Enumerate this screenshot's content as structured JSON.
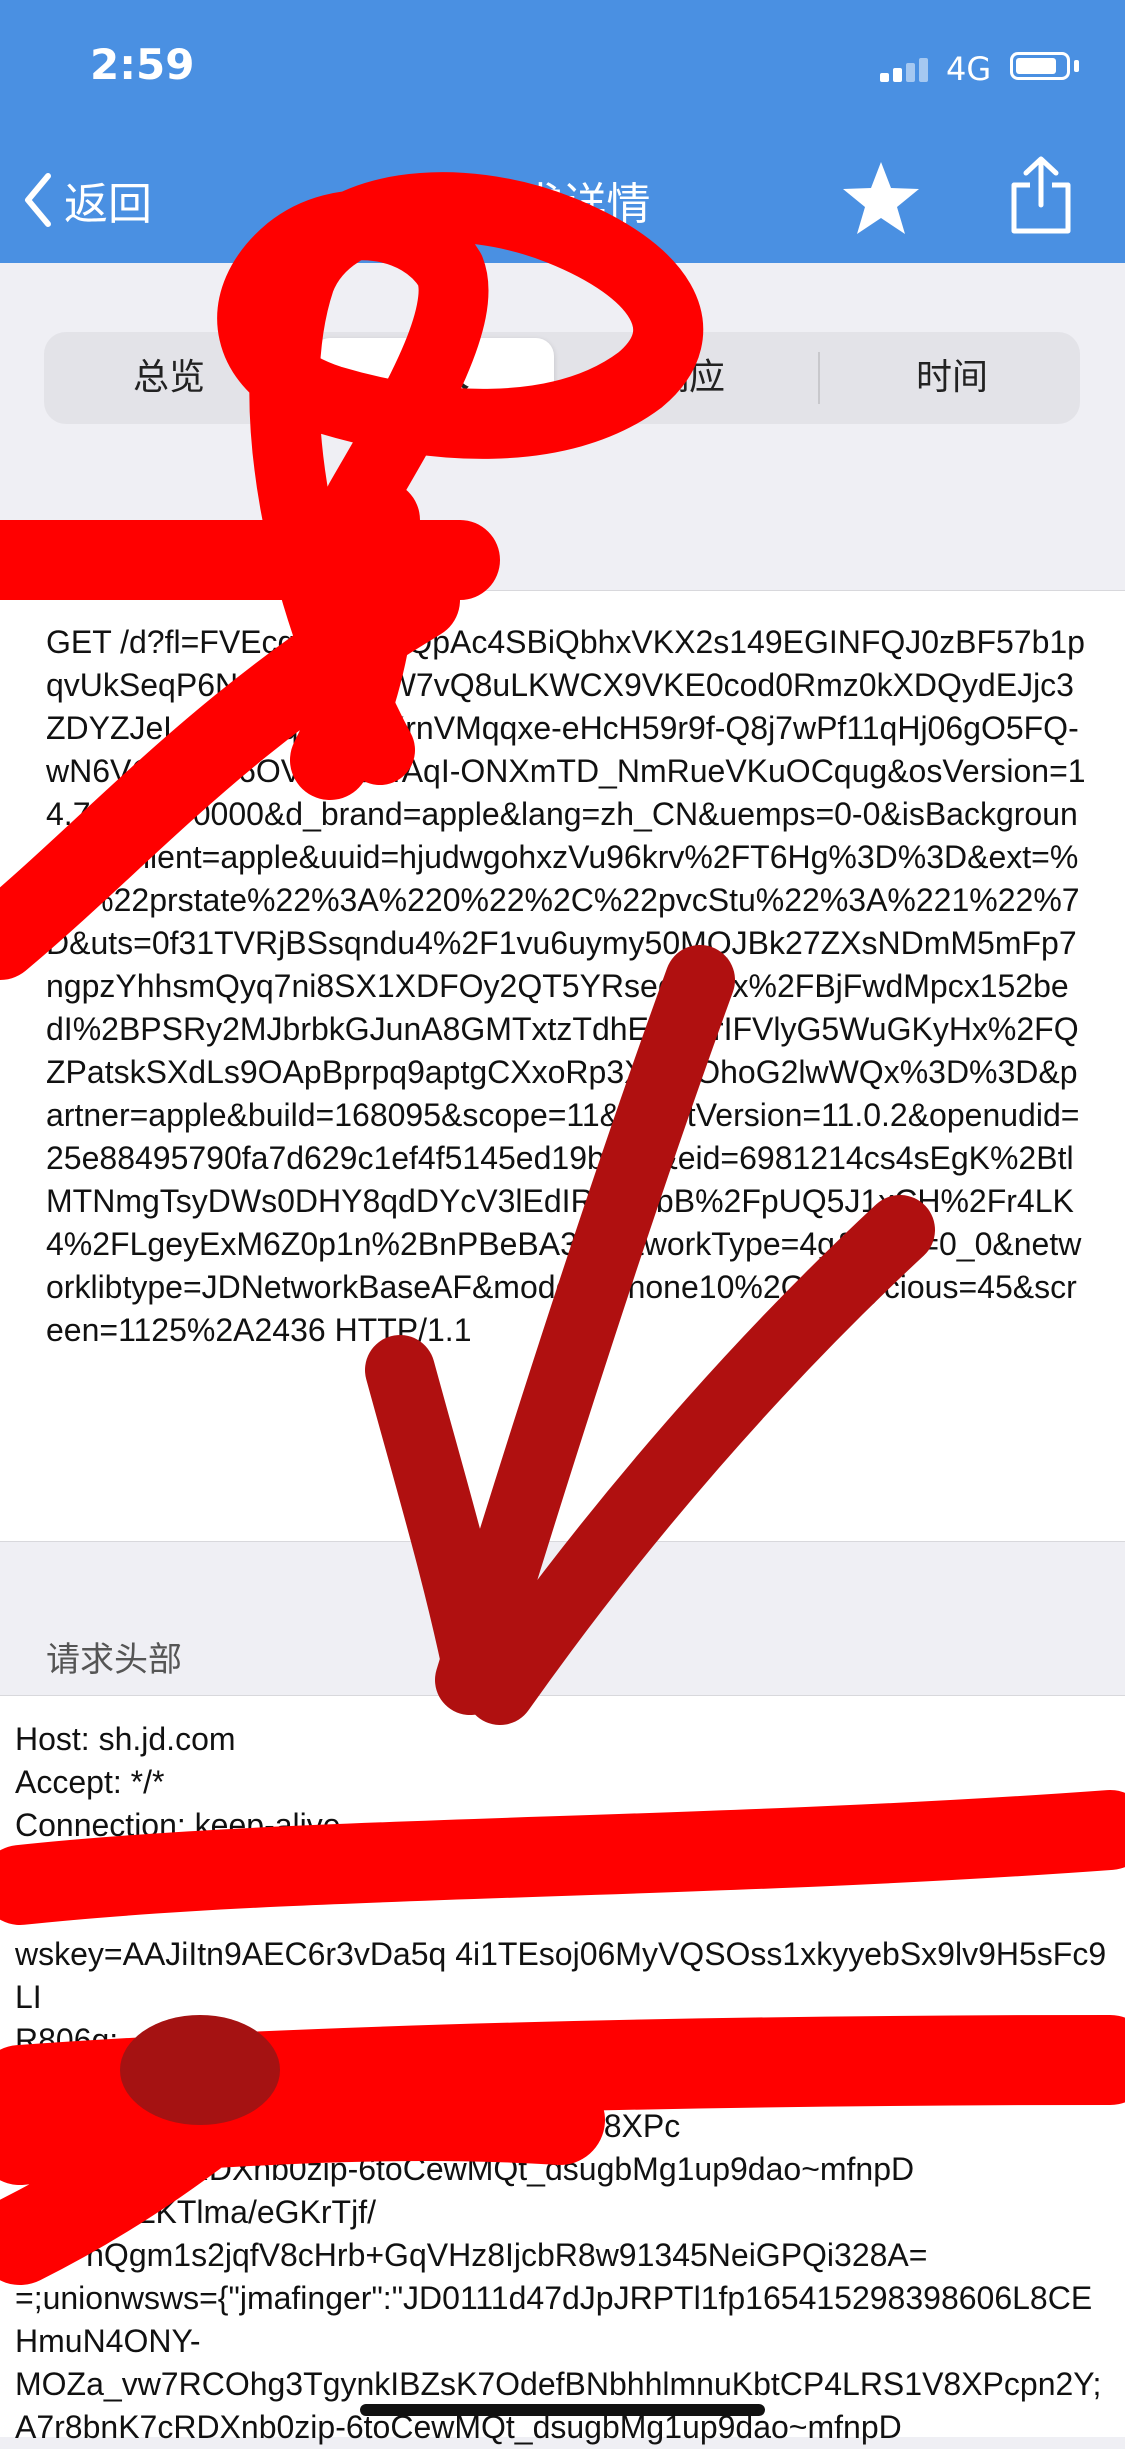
{
  "status_bar": {
    "time": "2:59",
    "network": "4G"
  },
  "nav": {
    "back_label": "返回",
    "title": "请求详情",
    "icons": [
      "chevron-left-icon",
      "star-icon",
      "share-icon"
    ]
  },
  "tabs": [
    {
      "label": "总览",
      "active": false
    },
    {
      "label": "请求",
      "active": true
    },
    {
      "label": "响应",
      "active": false
    },
    {
      "label": "时间",
      "active": false
    }
  ],
  "request_line": "GET /d?fl=FVEcqrZeTmoQpAc4SBiQbhxVKX2s149EGINFQJ0zBF57b1pqvUkSeqP6No_xyEBEkW7vQ8uLKWCX9VKE0cod0Rmz0kXDQydEJjc3ZDYZJeL4cfq3XqwVvjaKrnVMqqxe-eHcH59r9f-Q8j7wPf11qHj06gO5FQ-wN6VOhEBV6OV4ykOi4AqI-ONXmTD_NmRueVKuOCqug&osVersion=14.7.1&rfs=0000&d_brand=apple&lang=zh_CN&uemps=0-0&isBackground=N&client=apple&uuid=hjudwgohxzVu96krv%2FT6Hg%3D%3D&ext=%7B%22prstate%22%3A%220%22%2C%22pvcStu%22%3A%221%22%7D&uts=0f31TVRjBSsqndu4%2F1vu6uymy50MQJBk27ZXsNDmM5mFp7ngpzYhhsmQyq7ni8SX1XDFOy2QT5YRseqsuCx%2FBjFwdMpcx152bedI%2BPSRy2MJbrbkGJunA8GMTxtzTdhE7A2irIFVlyG5WuGKyHx%2FQZPatskSXdLs9OApBprpq9aptgCXxoRp3XWFOhoG2lwWQx%3D%3D&partner=apple&build=168095&scope=11&clientVersion=11.0.2&openudid=25e88495790fa7d629c1ef4f5145ed19b3cd&eid=6981214cs4sEgK%2BtlMTNmgTsyDWs0DHY8qdDYcV3lEdIRuXCbB%2FpUQ5J1xCH%2Fr4LK4%2FLgeyExM6Z0p1n%2BnPBeBA3&networkType=4g&area=0_0&networklibtype=JDNetworkBaseAF&model=iPhone10%2C2&joycious=45&screen=1125%2A2436 HTTP/1.1",
  "headers_section_title": "请求头部",
  "headers": [
    "Host: sh.jd.com",
    "Accept: */*",
    "Connection: keep-alive",
    "J",
    "C",
    "wskey=AAJiItn9AEC6r3vDa5q                4i1TEsoj06MyVQSOss1xkyyebSx9lv9H5sFc9LI",
    "R806q;",
    "",
    "                        bNbhhlmnuKbtCP4LRS1V8XPc",
    "        bmKgcRDXnb0zip-6toCewMQt_dsugbMg1up9dao~mfnpD",
    "        cLuLKTlma/eGKrTjf/",
    "        nQgm1s2jqfV8cHrb+GqVHz8IjcbR8w91345NeiGPQi328A=",
    "=;unionwsws={\"jmafinger\":\"JD0111d47dJpJRPTl1fp165415298398606L8CEHmuN4ONY-",
    "MOZa_vw7RCOhg3TgynkIBZsK7OdefBNbhhlmnuKbtCP4LRS1V8XPcpn2Y;A7r8bnK7cRDXnb0zip-6toCewMQt_dsugbMg1up9dao~mfnpD"
  ]
}
